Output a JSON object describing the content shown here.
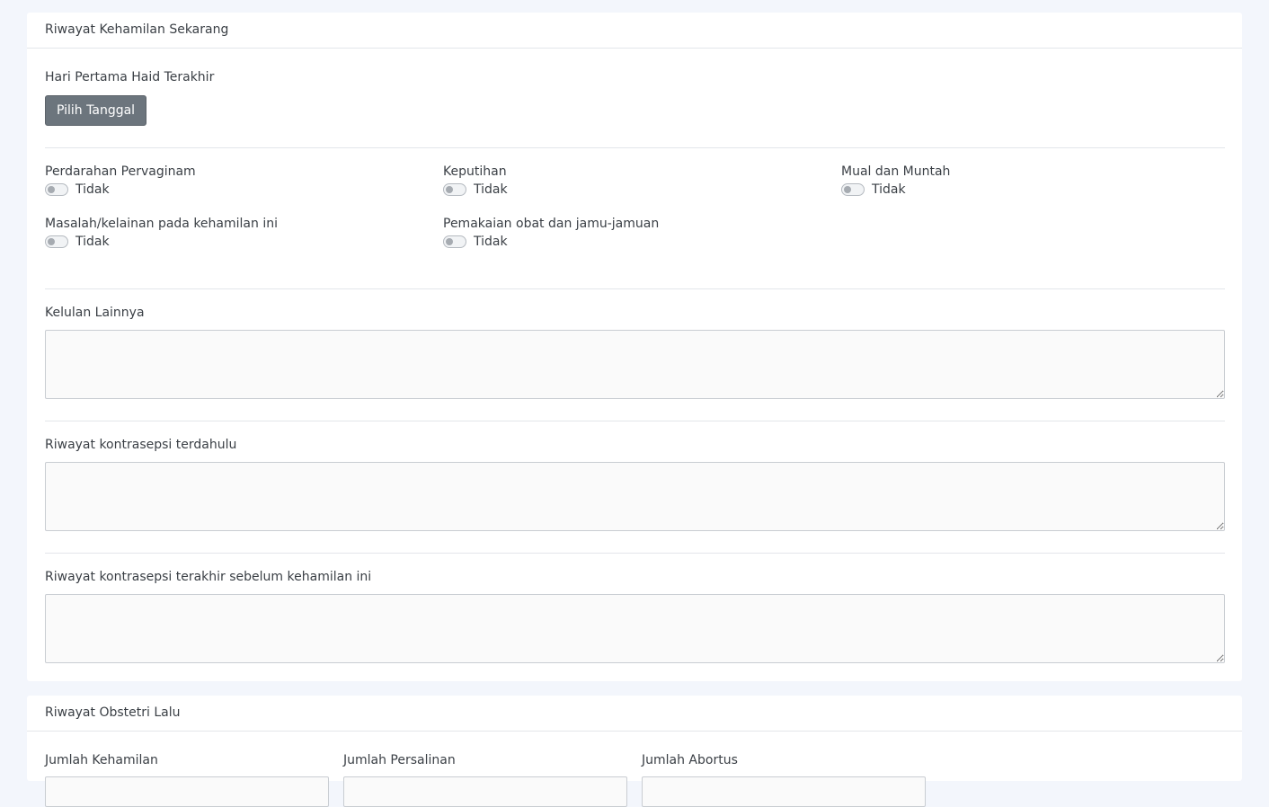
{
  "current_pregnancy": {
    "title": "Riwayat Kehamilan Sekarang",
    "lmp_label": "Hari Pertama Haid Terakhir",
    "pick_date_button": "Pilih Tanggal",
    "toggles": [
      {
        "label": "Perdarahan Pervaginam",
        "state": "Tidak"
      },
      {
        "label": "Keputihan",
        "state": "Tidak"
      },
      {
        "label": "Mual dan Muntah",
        "state": "Tidak"
      },
      {
        "label": "Masalah/kelainan pada kehamilan ini",
        "state": "Tidak"
      },
      {
        "label": "Pemakaian obat dan jamu-jamuan",
        "state": "Tidak"
      }
    ],
    "other_complaints_label": "Kelulan Lainnya",
    "other_complaints_value": "",
    "prev_contraception_label": "Riwayat kontrasepsi terdahulu",
    "prev_contraception_value": "",
    "last_contraception_label": "Riwayat kontrasepsi terakhir sebelum kehamilan ini",
    "last_contraception_value": ""
  },
  "obstetric_history": {
    "title": "Riwayat Obstetri Lalu",
    "fields": [
      {
        "label": "Jumlah Kehamilan",
        "value": ""
      },
      {
        "label": "Jumlah Persalinan",
        "value": ""
      },
      {
        "label": "Jumlah Abortus",
        "value": ""
      }
    ]
  }
}
